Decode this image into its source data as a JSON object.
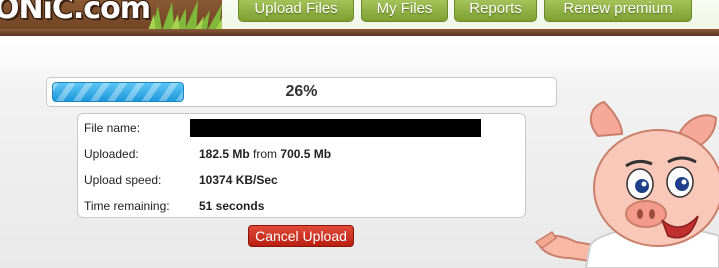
{
  "header": {
    "logo_text": "ONiC.com",
    "nav": [
      {
        "label": "Upload Files"
      },
      {
        "label": "My Files"
      },
      {
        "label": "Reports"
      },
      {
        "label": "Renew premium"
      }
    ]
  },
  "upload": {
    "progress_percent": 26,
    "progress_label": "26%",
    "file_name_label": "File name:",
    "uploaded_label": "Uploaded:",
    "uploaded_done": "182.5 Mb",
    "uploaded_from": "from",
    "uploaded_total": "700.5 Mb",
    "speed_label": "Upload speed:",
    "speed_value": "10374 KB/Sec",
    "remaining_label": "Time remaining:",
    "remaining_value": "51 seconds",
    "cancel_label": "Cancel Upload"
  },
  "colors": {
    "nav_green": "#8fb043",
    "progress_blue": "#2aa5e6",
    "cancel_red": "#cc2a1a",
    "header_brown": "#6b3f22"
  },
  "icons": {
    "mascot": "pig-mascot-icon"
  }
}
